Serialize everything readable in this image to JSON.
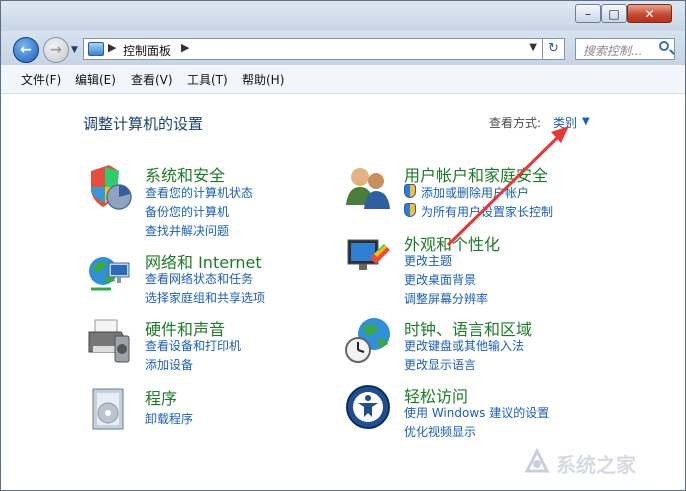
{
  "window": {
    "min_label": "–",
    "max_label": "□",
    "close_label": "✕"
  },
  "nav": {
    "back_icon": "←",
    "forward_icon": "→",
    "history_icon": "▼",
    "address_sep": "▶",
    "address_crumb": "控制面板",
    "address_sep2": "▶",
    "address_dropdown": "▼",
    "refresh_icon": "↻",
    "search_placeholder": "搜索控制..."
  },
  "menu": [
    "文件(F)",
    "编辑(E)",
    "查看(V)",
    "工具(T)",
    "帮助(H)"
  ],
  "page": {
    "title": "调整计算机的设置",
    "view_by_label": "查看方式:",
    "view_by_value": "类别",
    "view_by_arrow": "▼"
  },
  "left": [
    {
      "title": "系统和安全",
      "icon": "system-security-icon",
      "links": [
        "查看您的计算机状态",
        "备份您的计算机",
        "查找并解决问题"
      ]
    },
    {
      "title": "网络和 Internet",
      "icon": "network-icon",
      "links": [
        "查看网络状态和任务",
        "选择家庭组和共享选项"
      ]
    },
    {
      "title": "硬件和声音",
      "icon": "printer-icon",
      "links": [
        "查看设备和打印机",
        "添加设备"
      ]
    },
    {
      "title": "程序",
      "icon": "programs-icon",
      "links": [
        "卸载程序"
      ]
    }
  ],
  "right": [
    {
      "title": "用户帐户和家庭安全",
      "icon": "users-icon",
      "links": [
        "添加或删除用户帐户",
        "为所有用户设置家长控制"
      ]
    },
    {
      "title": "外观和个性化",
      "icon": "appearance-icon",
      "links": [
        "更改主题",
        "更改桌面背景",
        "调整屏幕分辨率"
      ]
    },
    {
      "title": "时钟、语言和区域",
      "icon": "clock-globe-icon",
      "links": [
        "更改键盘或其他输入法",
        "更改显示语言"
      ]
    },
    {
      "title": "轻松访问",
      "icon": "ease-of-access-icon",
      "links": [
        "使用 Windows 建议的设置",
        "优化视频显示"
      ]
    }
  ],
  "watermark": {
    "text": "系统之家"
  },
  "colors": {
    "category_title": "#1e7a29",
    "link": "#1b5fb4",
    "annotation_arrow": "#e53935"
  }
}
